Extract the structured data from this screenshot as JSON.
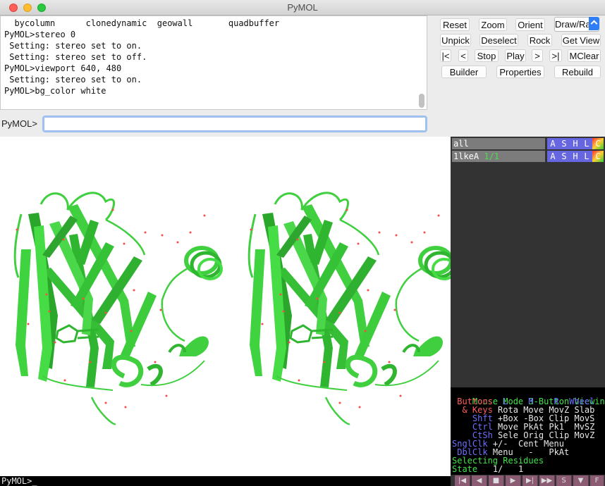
{
  "window": {
    "title": "PyMOL"
  },
  "console": {
    "lines": [
      "  bycolumn      clonedynamic  geowall       quadbuffer",
      "PyMOL>stereo 0",
      " Setting: stereo set to on.",
      " Setting: stereo set to off.",
      "PyMOL>viewport 640, 480",
      " Setting: stereo set to on.",
      "PyMOL>bg_color white"
    ]
  },
  "command": {
    "prompt": "PyMOL>",
    "value": ""
  },
  "buttons": {
    "reset": "Reset",
    "zoom": "Zoom",
    "orient": "Orient",
    "draw_ray": "Draw/Ray",
    "unpick": "Unpick",
    "deselect": "Deselect",
    "rock": "Rock",
    "get_view": "Get View",
    "rewind": "|<",
    "back": "<",
    "stop": "Stop",
    "play": "Play",
    "forward": ">",
    "end": ">|",
    "mclear": "MClear",
    "builder": "Builder",
    "properties": "Properties",
    "rebuild": "Rebuild"
  },
  "objects": [
    {
      "name": "all",
      "states": ""
    },
    {
      "name": "1lkeA",
      "states": "1/1"
    }
  ],
  "object_actions": [
    "A",
    "S",
    "H",
    "L",
    "C"
  ],
  "mouse_mode": {
    "title": "Mouse Mode",
    "mode": "3-Button Viewing",
    "header": [
      "Buttons",
      "L",
      "M",
      "R",
      "Wheel"
    ],
    "rows": [
      {
        "key": "& Keys",
        "values": [
          "Rota",
          "Move",
          "MovZ",
          "Slab"
        ]
      },
      {
        "key": "Shft",
        "values": [
          "+Box",
          "-Box",
          "Clip",
          "MovS"
        ]
      },
      {
        "key": "Ctrl",
        "values": [
          "Move",
          "PkAt",
          "Pk1",
          "MvSZ"
        ]
      },
      {
        "key": "CtSh",
        "values": [
          "Sele",
          "Orig",
          "Clip",
          "MovZ"
        ]
      }
    ],
    "sngl_clk": {
      "key": "SnglClk",
      "values": [
        "+/-",
        "Cent",
        "Menu"
      ]
    },
    "dbl_clk": {
      "key": "DblClk",
      "values": [
        "Menu",
        "-",
        "PkAt"
      ]
    },
    "selecting": "Selecting Residues",
    "state_label": "State",
    "state_value": "1/",
    "state_total": "1"
  },
  "status_line": "PyMOL>_",
  "movie_controls": [
    "|◀",
    "◀",
    "■",
    "▶",
    "▶|",
    "▶▶",
    "S",
    "▼",
    "F"
  ],
  "colors": {
    "cartoon": "#3fcf3f",
    "cartoon_dark": "#1f8f1f",
    "water": "#ff4a4a",
    "action_blue": "#6666e0",
    "action_c_from": "#ff3333",
    "action_c_to": "#33cc33"
  }
}
